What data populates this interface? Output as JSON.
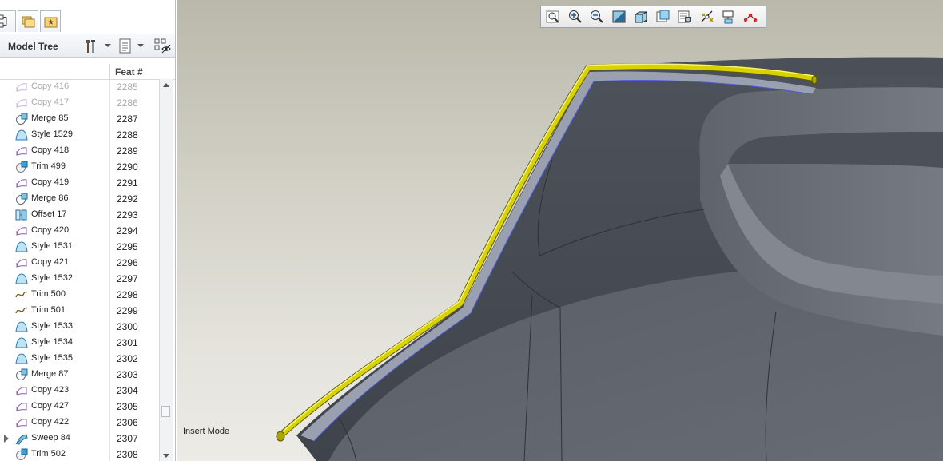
{
  "panel": {
    "tabs": [
      {
        "icon": "model-tree-tab-icon"
      },
      {
        "icon": "folder-browser-tab-icon"
      },
      {
        "icon": "favorites-tab-icon"
      }
    ],
    "title": "Model Tree",
    "column_header": "Feat #",
    "toolbar_icons": [
      "settings-tools-icon",
      "show-list-icon",
      "tree-filters-icon"
    ]
  },
  "tree_rows": [
    {
      "label": "Copy 416",
      "feat": "2285",
      "icon": "copy-surface-icon",
      "suppressed": true
    },
    {
      "label": "Copy 417",
      "feat": "2286",
      "icon": "copy-surface-icon",
      "suppressed": true
    },
    {
      "label": "Merge 85",
      "feat": "2287",
      "icon": "merge-icon"
    },
    {
      "label": "Style 1529",
      "feat": "2288",
      "icon": "style-surface-icon"
    },
    {
      "label": "Copy 418",
      "feat": "2289",
      "icon": "copy-surface-icon"
    },
    {
      "label": "Trim 499",
      "feat": "2290",
      "icon": "trim-icon"
    },
    {
      "label": "Copy 419",
      "feat": "2291",
      "icon": "copy-surface-icon"
    },
    {
      "label": "Merge 86",
      "feat": "2292",
      "icon": "merge-icon"
    },
    {
      "label": "Offset 17",
      "feat": "2293",
      "icon": "offset-icon"
    },
    {
      "label": "Copy 420",
      "feat": "2294",
      "icon": "copy-surface-icon"
    },
    {
      "label": "Style 1531",
      "feat": "2295",
      "icon": "style-surface-icon"
    },
    {
      "label": "Copy 421",
      "feat": "2296",
      "icon": "copy-surface-icon"
    },
    {
      "label": "Style 1532",
      "feat": "2297",
      "icon": "style-surface-icon"
    },
    {
      "label": "Trim 500",
      "feat": "2298",
      "icon": "curve-trim-icon"
    },
    {
      "label": "Trim 501",
      "feat": "2299",
      "icon": "curve-trim-icon"
    },
    {
      "label": "Style 1533",
      "feat": "2300",
      "icon": "style-surface-icon"
    },
    {
      "label": "Style 1534",
      "feat": "2301",
      "icon": "style-surface-icon"
    },
    {
      "label": "Style 1535",
      "feat": "2302",
      "icon": "style-surface-icon"
    },
    {
      "label": "Merge 87",
      "feat": "2303",
      "icon": "merge-icon"
    },
    {
      "label": "Copy 423",
      "feat": "2304",
      "icon": "copy-surface-icon"
    },
    {
      "label": "Copy 427",
      "feat": "2305",
      "icon": "copy-surface-icon"
    },
    {
      "label": "Copy 422",
      "feat": "2306",
      "icon": "copy-surface-icon"
    },
    {
      "label": "Sweep 84",
      "feat": "2307",
      "icon": "sweep-icon",
      "expandable": true
    },
    {
      "label": "Trim 502",
      "feat": "2308",
      "icon": "trim-icon"
    }
  ],
  "viewport": {
    "status_text": "Insert Mode",
    "view_toolbar": [
      "refit-icon",
      "zoom-in-icon",
      "zoom-out-icon",
      "repaint-icon",
      "display-style-icon",
      "saved-views-icon",
      "view-manager-icon",
      "datum-display-icon",
      "annotation-display-icon",
      "spin-center-icon"
    ]
  },
  "colors": {
    "model_surface": "#4a4e57",
    "sweep_highlight": "#d8d200",
    "edge_highlight": "#4c5cd8"
  }
}
